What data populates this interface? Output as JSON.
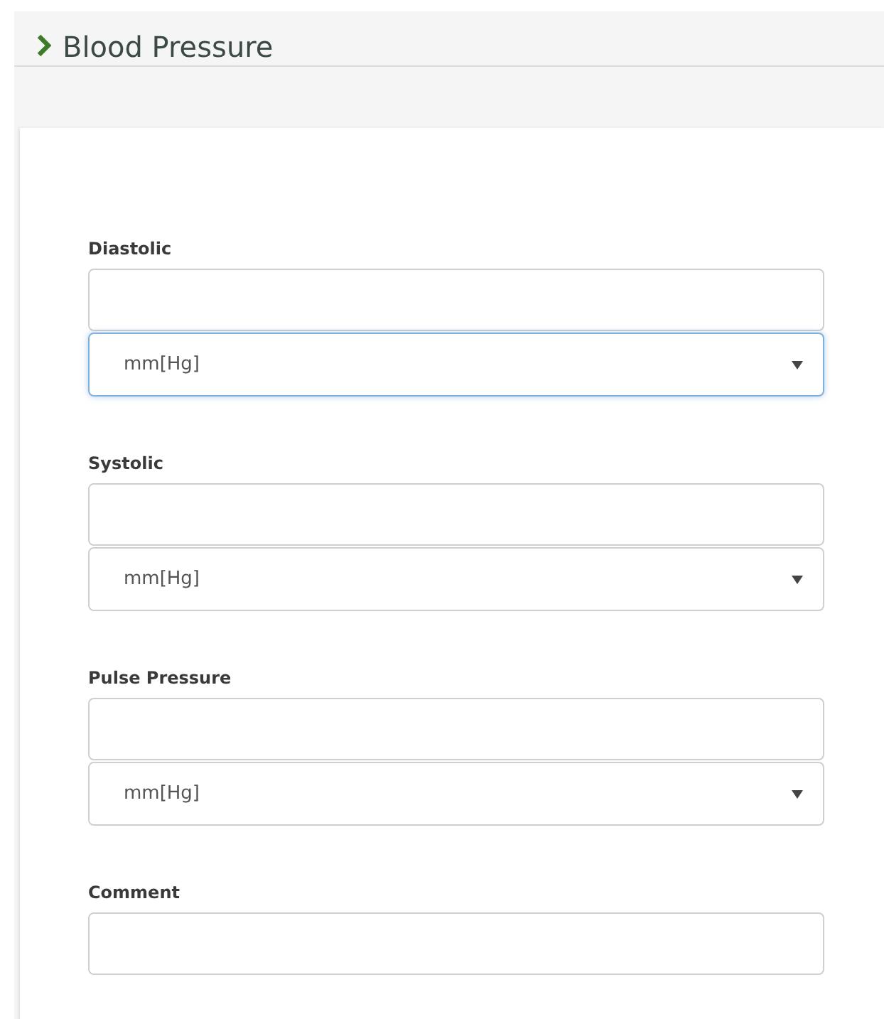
{
  "section": {
    "title": "Blood Pressure",
    "expanded": false
  },
  "fields": [
    {
      "kind": "measure",
      "label": "Diastolic",
      "unit": "mm[Hg]",
      "focused": true
    },
    {
      "kind": "measure",
      "label": "Systolic",
      "unit": "mm[Hg]",
      "focused": false
    },
    {
      "kind": "measure",
      "label": "Pulse Pressure",
      "unit": "mm[Hg]",
      "focused": false
    },
    {
      "kind": "text",
      "label": "Comment"
    }
  ]
}
